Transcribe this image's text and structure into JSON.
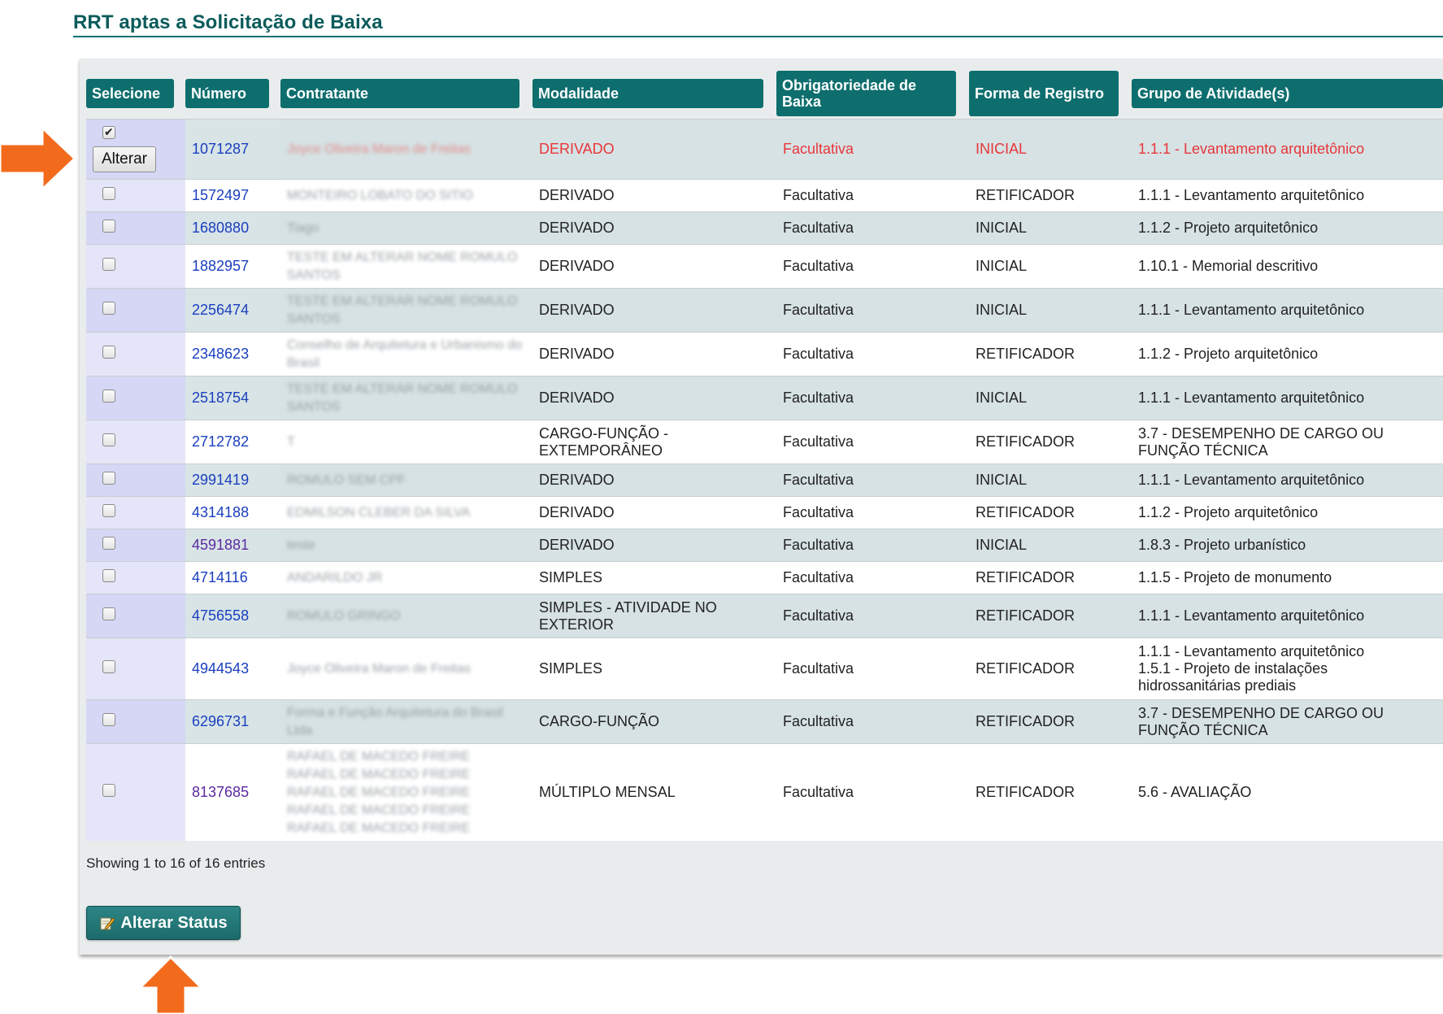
{
  "page_title": "RRT aptas a Solicitação de Baixa",
  "columns": {
    "select": "Selecione",
    "number": "Número",
    "contractor": "Contratante",
    "modality": "Modalidade",
    "obligation": "Obrigatoriedade de Baixa",
    "registration": "Forma de Registro",
    "activity_group": "Grupo de Atividade(s)"
  },
  "alter_button_label": "Alterar",
  "rows": [
    {
      "checked": true,
      "number": "1071287",
      "contractor": "Joyce Oliveira Maron de Freitas",
      "modality": "DERIVADO",
      "obligation": "Facultativa",
      "registration": "INICIAL",
      "activity": "1.1.1 - Levantamento arquitetônico"
    },
    {
      "checked": false,
      "number": "1572497",
      "contractor": "MONTEIRO LOBATO DO SITIO",
      "modality": "DERIVADO",
      "obligation": "Facultativa",
      "registration": "RETIFICADOR",
      "activity": "1.1.1 - Levantamento arquitetônico"
    },
    {
      "checked": false,
      "number": "1680880",
      "contractor": "Tiago",
      "modality": "DERIVADO",
      "obligation": "Facultativa",
      "registration": "INICIAL",
      "activity": "1.1.2 - Projeto arquitetônico"
    },
    {
      "checked": false,
      "number": "1882957",
      "contractor": "TESTE EM ALTERAR NOME ROMULO SANTOS",
      "modality": "DERIVADO",
      "obligation": "Facultativa",
      "registration": "INICIAL",
      "activity": "1.10.1 - Memorial descritivo"
    },
    {
      "checked": false,
      "number": "2256474",
      "contractor": "TESTE EM ALTERAR NOME ROMULO SANTOS",
      "modality": "DERIVADO",
      "obligation": "Facultativa",
      "registration": "INICIAL",
      "activity": "1.1.1 - Levantamento arquitetônico"
    },
    {
      "checked": false,
      "number": "2348623",
      "contractor": "Conselho de Arquitetura e Urbanismo do Brasil",
      "modality": "DERIVADO",
      "obligation": "Facultativa",
      "registration": "RETIFICADOR",
      "activity": "1.1.2 - Projeto arquitetônico"
    },
    {
      "checked": false,
      "number": "2518754",
      "contractor": "TESTE EM ALTERAR NOME ROMULO SANTOS",
      "modality": "DERIVADO",
      "obligation": "Facultativa",
      "registration": "INICIAL",
      "activity": "1.1.1 - Levantamento arquitetônico"
    },
    {
      "checked": false,
      "number": "2712782",
      "contractor": "T",
      "modality": "CARGO-FUNÇÃO - EXTEMPORÂNEO",
      "obligation": "Facultativa",
      "registration": "RETIFICADOR",
      "activity": "3.7 - DESEMPENHO DE CARGO OU FUNÇÃO TÉCNICA"
    },
    {
      "checked": false,
      "number": "2991419",
      "contractor": "ROMULO SEM CPF",
      "modality": "DERIVADO",
      "obligation": "Facultativa",
      "registration": "INICIAL",
      "activity": "1.1.1 - Levantamento arquitetônico"
    },
    {
      "checked": false,
      "number": "4314188",
      "contractor": "EDMILSON CLEBER DA SILVA",
      "modality": "DERIVADO",
      "obligation": "Facultativa",
      "registration": "RETIFICADOR",
      "activity": "1.1.2 - Projeto arquitetônico"
    },
    {
      "checked": false,
      "number": "4591881",
      "contractor": "teste",
      "modality": "DERIVADO",
      "obligation": "Facultativa",
      "registration": "INICIAL",
      "activity": "1.8.3 - Projeto urbanístico"
    },
    {
      "checked": false,
      "number": "4714116",
      "contractor": "ANDARILDO JR",
      "modality": "SIMPLES",
      "obligation": "Facultativa",
      "registration": "RETIFICADOR",
      "activity": "1.1.5 - Projeto de monumento"
    },
    {
      "checked": false,
      "number": "4756558",
      "contractor": "ROMULO GRINGO",
      "modality": "SIMPLES - ATIVIDADE NO EXTERIOR",
      "obligation": "Facultativa",
      "registration": "RETIFICADOR",
      "activity": "1.1.1 - Levantamento arquitetônico"
    },
    {
      "checked": false,
      "number": "4944543",
      "contractor": "Joyce Oliveira Maron de Freitas",
      "modality": "SIMPLES",
      "obligation": "Facultativa",
      "registration": "RETIFICADOR",
      "activity": "1.1.1 - Levantamento arquitetônico\n1.5.1 - Projeto de instalações hidrossanitárias prediais"
    },
    {
      "checked": false,
      "number": "6296731",
      "contractor": "Forma e Função Arquitetura do Brasil Ltda",
      "modality": "CARGO-FUNÇÃO",
      "obligation": "Facultativa",
      "registration": "RETIFICADOR",
      "activity": "3.7 - DESEMPENHO DE CARGO OU FUNÇÃO TÉCNICA"
    },
    {
      "checked": false,
      "number": "8137685",
      "contractor": "RAFAEL DE MACEDO FREIRE\nRAFAEL DE MACEDO FREIRE\nRAFAEL DE MACEDO FREIRE\nRAFAEL DE MACEDO FREIRE\nRAFAEL DE MACEDO FREIRE",
      "modality": "MÚLTIPLO MENSAL",
      "obligation": "Facultativa",
      "registration": "RETIFICADOR",
      "activity": "5.6 - AVALIAÇÃO"
    }
  ],
  "footer": {
    "showing": "Showing 1 to 16 of 16 entries",
    "status_button": "Alterar Status"
  },
  "colors": {
    "header_bg": "#0e6e6e",
    "selected_row_text": "#e8363a",
    "link": "#1a3fbf",
    "arrow": "#f26b1d"
  },
  "icons": {
    "status_button_icon": "pencil-icon",
    "annotations": [
      "arrow-right-icon",
      "arrow-up-icon"
    ]
  }
}
